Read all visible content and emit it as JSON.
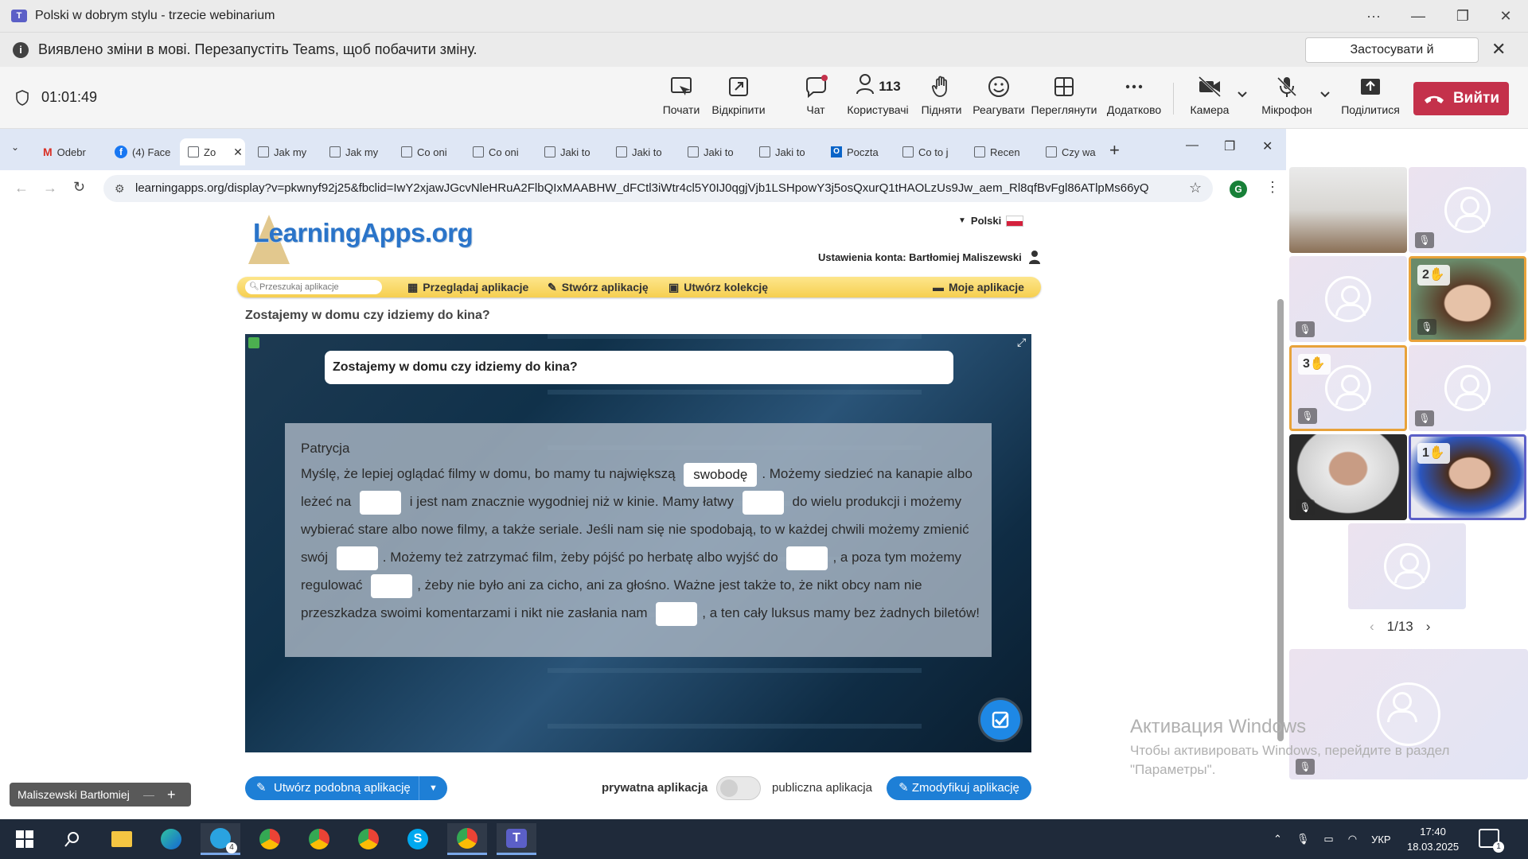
{
  "window": {
    "title": "Polski w dobrym stylu - trzecie webinarium"
  },
  "notice": {
    "message": "Виявлено зміни в мові. Перезапустіть Teams, щоб побачити зміну.",
    "apply_label": "Застосувати й перезапустити"
  },
  "meeting": {
    "timer": "01:01:49",
    "toolbar": {
      "start": "Почати",
      "open": "Відкріпити",
      "chat": "Чат",
      "people_label": "Користувачі",
      "people_count": "113",
      "raise": "Підняти",
      "react": "Реагувати",
      "view": "Переглянути",
      "more": "Додатково",
      "camera": "Камера",
      "mic": "Мікрофон",
      "share": "Поділитися",
      "leave": "Вийти"
    }
  },
  "browser": {
    "tabs": [
      "Odebr",
      "(4) Face",
      "Zo",
      "Jak my",
      "Jak my",
      "Co oni",
      "Co oni",
      "Jaki to",
      "Jaki to",
      "Jaki to",
      "Jaki to",
      "Poczta",
      "Co to j",
      "Recen",
      "Czy wa"
    ],
    "url": "learningapps.org/display?v=pkwnyf92j25&fbclid=IwY2xjawJGcvNleHRuA2FlbQIxMAABHW_dFCtl3iWtr4cl5Y0IJ0qgjVjb1LSHpowY3j5osQxurQ1tHAOLzUs9Jw_aem_Rl8qfBvFgl86ATlpMs66yQ",
    "profile_initial": "G"
  },
  "site": {
    "logo": "LearningApps.org",
    "language": "Polski",
    "account": "Ustawienia konta: Bartłomiej Maliszewski",
    "search_placeholder": "Przeszukaj aplikacje",
    "nav": {
      "browse": "Przeglądaj aplikacje",
      "create": "Stwórz aplikację",
      "collection": "Utwórz kolekcję",
      "mine": "Moje aplikacje"
    },
    "app_title": "Zostajemy w domu czy idziemy do kina?",
    "app": {
      "question": "Zostajemy w domu czy idziemy do kina?",
      "author": "Patrycja",
      "segments": [
        "Myślę, że lepiej oglądać filmy w domu, bo mamy tu największą",
        ". Możemy siedzieć na kanapie albo leżeć na",
        "i jest nam znacznie wygodniej niż w kinie. Mamy łatwy",
        "do wielu produkcji i możemy wybierać stare albo nowe filmy, a także seriale. Jeśli nam się nie spodobają, to w każdej chwili możemy zmienić swój",
        ". Możemy też zatrzymać film, żeby pójść po herbatę albo wyjść do",
        ", a poza tym możemy regulować",
        ", żeby nie było ani za cicho, ani za głośno. Ważne jest także to, że nikt obcy nam nie przeszkadza swoimi komentarzami i nikt nie zasłania nam",
        ", a ten cały luksus mamy bez żadnych biletów!"
      ],
      "filled_gap": "swobodę"
    },
    "similar_btn": "Utwórz podobną aplikację",
    "private_label": "prywatna aplikacja",
    "public_label": "publiczna aplikacja",
    "modify_btn": "Zmodyfikuj aplikację"
  },
  "gallery": {
    "hands": {
      "a": "2",
      "b": "3",
      "c": "1"
    },
    "pager": "1/13"
  },
  "name_tag": "Maliszewski Bartłomiej",
  "activation": {
    "title": "Активация Windows",
    "body": "Чтобы активировать Windows, перейдите в раздел \"Параметры\"."
  },
  "taskbar": {
    "lang": "УКР",
    "time": "17:40",
    "date": "18.03.2025",
    "notif_count": "1",
    "telegram_badge": "4"
  },
  "colors": {
    "teams_purple": "#5b5fc7",
    "leave_red": "#c4314b",
    "la_blue": "#1e7fd6",
    "la_yellow": "#f6cf50"
  }
}
